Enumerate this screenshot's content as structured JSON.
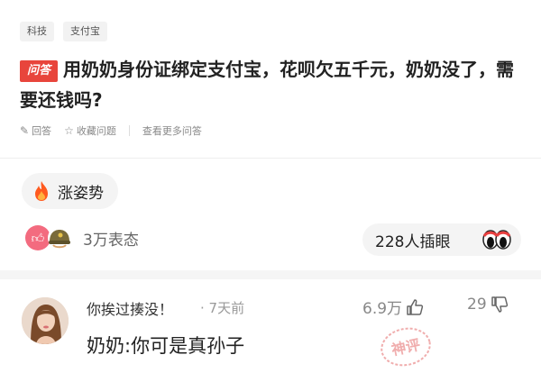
{
  "question": {
    "tags": [
      "科技",
      "支付宝"
    ],
    "badge": "问答",
    "title": "用奶奶身份证绑定支付宝，花呗欠五千元，奶奶没了，需要还钱吗?",
    "actions": {
      "answer": "回答",
      "favorite": "收藏问题",
      "more": "查看更多问答"
    }
  },
  "trend": {
    "label": "涨姿势"
  },
  "reactions": {
    "count_label": "3万表态"
  },
  "viewers": {
    "label": "228人插眼"
  },
  "comment": {
    "author": "你挨过揍没！",
    "time": "· 7天前",
    "likes": "6.9万",
    "dislikes": "29",
    "text": "奶奶:你可是真孙子",
    "stamp_text": "神评"
  },
  "colors": {
    "badge_red": "#e8453c",
    "like_pink": "#f36b7f",
    "stamp_red": "#e46b6b"
  }
}
